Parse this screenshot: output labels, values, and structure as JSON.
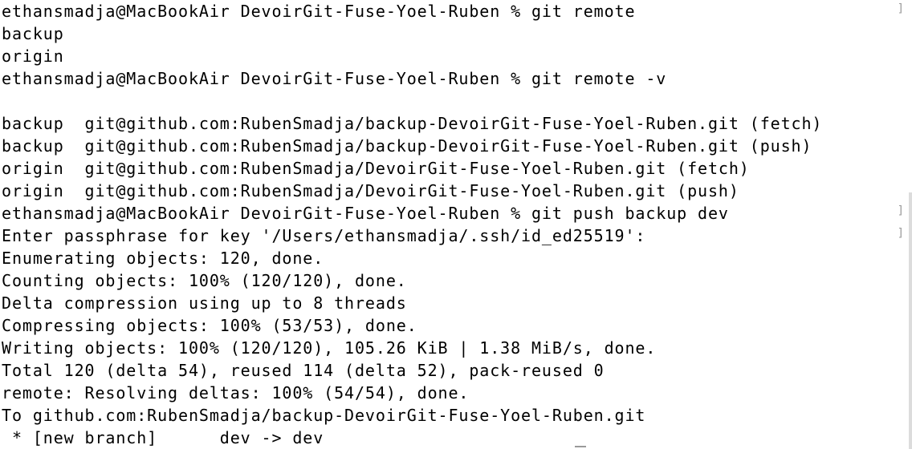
{
  "terminal": {
    "lines": [
      "ethansmadja@MacBookAir DevoirGit-Fuse-Yoel-Ruben % git remote",
      "backup",
      "origin",
      "ethansmadja@MacBookAir DevoirGit-Fuse-Yoel-Ruben % git remote -v",
      "",
      "backup  git@github.com:RubenSmadja/backup-DevoirGit-Fuse-Yoel-Ruben.git (fetch)",
      "backup  git@github.com:RubenSmadja/backup-DevoirGit-Fuse-Yoel-Ruben.git (push)",
      "origin  git@github.com:RubenSmadja/DevoirGit-Fuse-Yoel-Ruben.git (fetch)",
      "origin  git@github.com:RubenSmadja/DevoirGit-Fuse-Yoel-Ruben.git (push)",
      "ethansmadja@MacBookAir DevoirGit-Fuse-Yoel-Ruben % git push backup dev",
      "Enter passphrase for key '/Users/ethansmadja/.ssh/id_ed25519':",
      "Enumerating objects: 120, done.",
      "Counting objects: 100% (120/120), done.",
      "Delta compression using up to 8 threads",
      "Compressing objects: 100% (53/53), done.",
      "Writing objects: 100% (120/120), 105.26 KiB | 1.38 MiB/s, done.",
      "Total 120 (delta 54), reused 114 (delta 52), pack-reused 0",
      "remote: Resolving deltas: 100% (54/54), done.",
      "To github.com:RubenSmadja/backup-DevoirGit-Fuse-Yoel-Ruben.git",
      " * [new branch]      dev -> dev"
    ]
  }
}
